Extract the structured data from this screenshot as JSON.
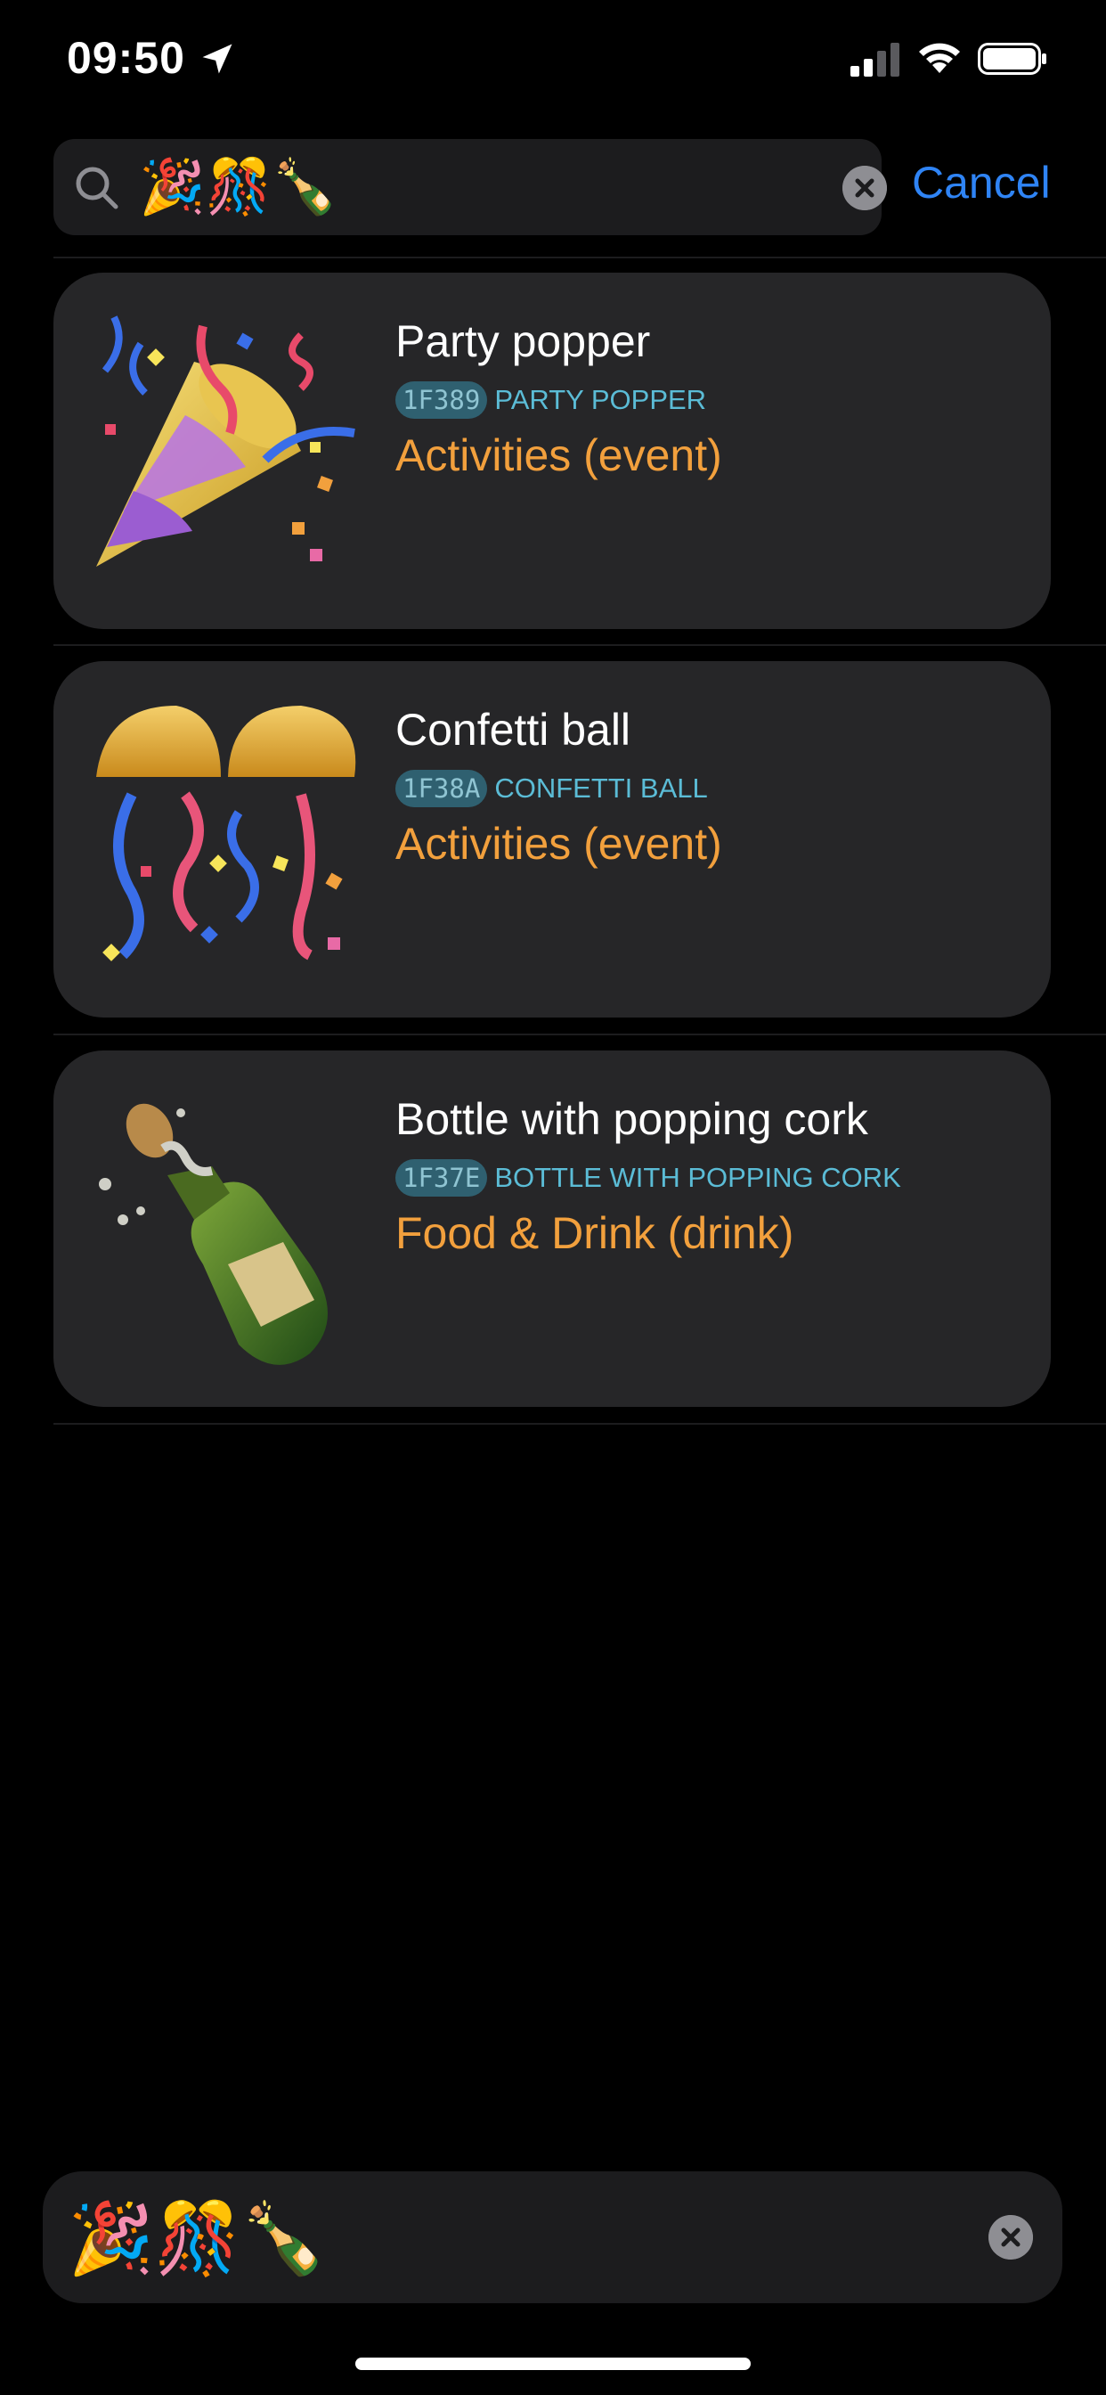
{
  "status_bar": {
    "time": "09:50"
  },
  "search": {
    "query": "🎉🎊🍾",
    "cancel_label": "Cancel"
  },
  "results": [
    {
      "title": "Party popper",
      "code": "1F389",
      "unicode_name": "PARTY POPPER",
      "category": "Activities (event)",
      "icon": "party-popper-icon"
    },
    {
      "title": "Confetti ball",
      "code": "1F38A",
      "unicode_name": "CONFETTI BALL",
      "category": "Activities (event)",
      "icon": "confetti-ball-icon"
    },
    {
      "title": "Bottle with popping cork",
      "code": "1F37E",
      "unicode_name": "BOTTLE WITH POPPING CORK",
      "category": "Food & Drink (drink)",
      "icon": "bottle-popping-cork-icon"
    }
  ],
  "bottom_field": {
    "value": "🎉🎊🍾"
  },
  "colors": {
    "accent": "#2f84f5",
    "category": "#f2a03d",
    "code_text": "#5bbcd6",
    "card": "#262628"
  }
}
